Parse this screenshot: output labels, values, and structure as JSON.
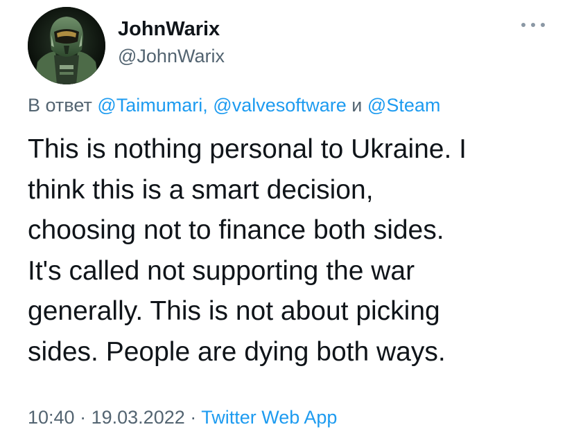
{
  "author": {
    "display_name": "JohnWarix",
    "handle": "@JohnWarix"
  },
  "reply": {
    "prefix": "В ответ",
    "mentions": [
      "@Taimumari,",
      "@valvesoftware",
      "@Steam"
    ],
    "conjunction": "и"
  },
  "tweet": {
    "lines": [
      "This is nothing personal to Ukraine. I",
      "think this is a smart decision,",
      "choosing not to finance both sides.",
      "It's called not supporting the war",
      "generally. This is not about picking",
      "sides. People are dying both ways."
    ]
  },
  "meta": {
    "time": "10:40",
    "separator": "·",
    "date": "19.03.2022",
    "source": "Twitter Web App"
  },
  "icons": {
    "more": "more-horizontal-icon"
  },
  "colors": {
    "text": "#0f1419",
    "secondary": "#536471",
    "link": "#1d9bf0",
    "background": "#ffffff"
  }
}
